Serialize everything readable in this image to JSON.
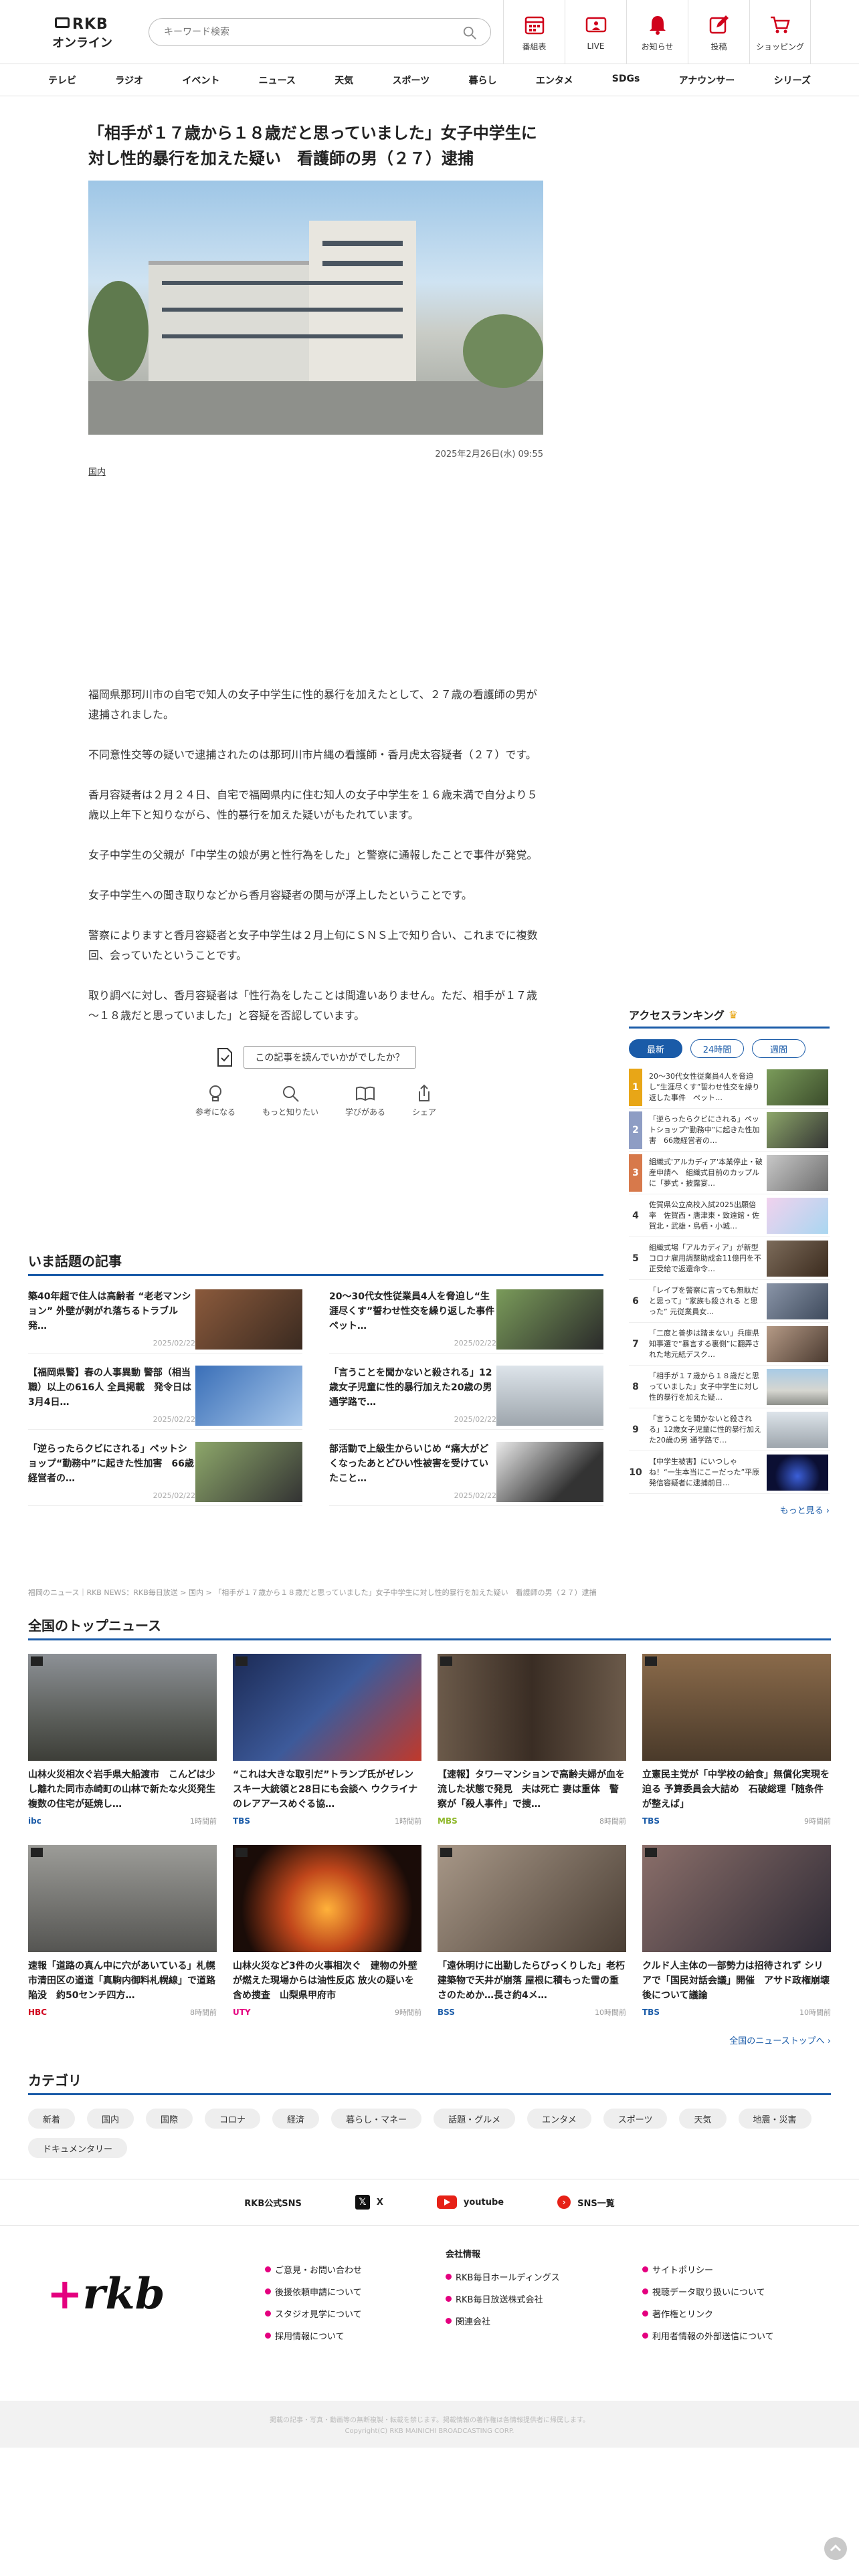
{
  "header": {
    "logo_top": "RKB",
    "logo_bottom": "オンライン",
    "search_placeholder": "キーワード検索",
    "nav": [
      {
        "label": "番組表"
      },
      {
        "label": "LIVE"
      },
      {
        "label": "お知らせ"
      },
      {
        "label": "投稿"
      },
      {
        "label": "ショッピング"
      }
    ]
  },
  "categories_nav": [
    "テレビ",
    "ラジオ",
    "イベント",
    "ニュース",
    "天気",
    "スポーツ",
    "暮らし",
    "エンタメ",
    "SDGs",
    "アナウンサー",
    "シリーズ"
  ],
  "article": {
    "title": "「相手が１７歳から１８歳だと思っていました」女子中学生に対し性的暴行を加えた疑い　看護師の男（２７）逮捕",
    "date": "2025年2月26日(水) 09:55",
    "tag": "国内",
    "paragraphs": [
      "福岡県那珂川市の自宅で知人の女子中学生に性的暴行を加えたとして、２７歳の看護師の男が逮捕されました。",
      "不同意性交等の疑いで逮捕されたのは那珂川市片縄の看護師・香月虎太容疑者（２７）です。",
      "香月容疑者は２月２４日、自宅で福岡県内に住む知人の女子中学生を１６歳未満で自分より５歳以上年下と知りながら、性的暴行を加えた疑いがもたれています。",
      "女子中学生の父親が「中学生の娘が男と性行為をした」と警察に通報したことで事件が発覚。",
      "女子中学生への聞き取りなどから香月容疑者の関与が浮上したということです。",
      "警察によりますと香月容疑者と女子中学生は２月上旬にＳＮＳ上で知り合い、これまでに複数回、会っていたということです。",
      "取り調べに対し、香月容疑者は「性行為をしたことは間違いありません。ただ、相手が１７歳～１８歳だと思っていました」と容疑を否認しています。"
    ],
    "feedback_label": "この記事を読んでいかがでしたか？",
    "reactions": [
      "参考になる",
      "もっと知りたい",
      "学びがある",
      "シェア"
    ]
  },
  "trending": {
    "title": "いま話題の記事",
    "items": [
      {
        "title": "築40年超で住人は高齢者 “老老マンション” 外壁が剥がれ落ちるトラブル発…",
        "date": "2025/02/22"
      },
      {
        "title": "20～30代女性従業員4人を脅迫し“生涯尽くす”誓わせ性交を繰り返した事件　ペット…",
        "date": "2025/02/22"
      },
      {
        "title": "【福岡県警】春の人事異動 警部（相当職）以上の616人 全員掲載　発令日は3月4日…",
        "date": "2025/02/22"
      },
      {
        "title": "「言うことを聞かないと殺される」12歳女子児童に性的暴行加えた20歳の男 通学路で…",
        "date": "2025/02/22"
      },
      {
        "title": "「逆らったらクビにされる」ペットショップ“勤務中”に起きた性加害　66歳経営者の…",
        "date": "2025/02/22"
      },
      {
        "title": "部活動で上級生からいじめ “痛大がどくなったあとどひい性被害を受けていたこと…",
        "date": "2025/02/22"
      }
    ]
  },
  "ranking": {
    "title": "アクセスランキング",
    "tabs": [
      "最新",
      "24時間",
      "週間"
    ],
    "more": "もっと見る",
    "items": [
      {
        "num": "1",
        "title": "20～30代女性従業員4人を脅迫し“生涯尽くす”誓わせ性交を繰り返した事件　ペット…",
        "color": "#e8a617"
      },
      {
        "num": "2",
        "title": "「逆らったらクビにされる」ペットショップ“勤務中”に起きた性加害　66歳経営者の…",
        "color": "#8e9dc4"
      },
      {
        "num": "3",
        "title": "組織式'アルカディア'本業停止・破産申請へ　組織式目前のカップルに「夢式・披露宴…",
        "color": "#d7794b"
      },
      {
        "num": "4",
        "title": "佐賀県公立高校入試2025出願倍率　佐賀西・唐津東・致遠館・佐賀北・武雄・鳥栖・小城…",
        "color": ""
      },
      {
        "num": "5",
        "title": "組織式場「アルカディア」が新型コロナ雇用調整助成金11億円を不正受給で返還命令…",
        "color": ""
      },
      {
        "num": "6",
        "title": "「レイプを警察に言っても無駄だと思って」“家族も殺される と思った” 元従業員女…",
        "color": ""
      },
      {
        "num": "7",
        "title": "「二度と善歩は踏まない」兵庫県知事選で“暴言する裏側”に翻弄された地元紙デスク…",
        "color": ""
      },
      {
        "num": "8",
        "title": "「相手が１７歳から１８歳だと思っていました」女子中学生に対し性的暴行を加えた疑…",
        "color": ""
      },
      {
        "num": "9",
        "title": "「言うことを聞かないと殺される」12歳女子児童に性的暴行加えた20歳の男 通学路で…",
        "color": ""
      },
      {
        "num": "10",
        "title": "【中学生被害】にいつしゃね！“一生本当にこーだった”平原発信容疑者に逮捕前日…",
        "color": ""
      }
    ]
  },
  "breadcrumb": "福岡のニュース｜RKB NEWS：RKB毎日放送 > 国内 > 「相手が１７歳から１８歳だと思っていました」女子中学生に対し性的暴行を加えた疑い　看護師の男（２７）逮捕",
  "topnews": {
    "title": "全国のトップニュース",
    "link": "全国のニューストップへ",
    "items": [
      {
        "title": "山林火災相次ぐ岩手県大船渡市　こんどは少し離れた同市赤崎町の山林で新たな火災発生　複数の住宅が延焼し…",
        "src": "ibc",
        "ago": "1時間前",
        "srccolor": "#1a5ba8"
      },
      {
        "title": "“これは大きな取引だ”トランプ氏がゼレンスキー大統領と28日にも会談へ ウクライナのレアアースめぐる協…",
        "src": "TBS",
        "ago": "1時間前",
        "srccolor": "#1a5ba8"
      },
      {
        "title": "【速報】タワーマンションで高齢夫婦が血を流した状態で発見　夫は死亡 妻は重体　警察が「殺人事件」で捜…",
        "src": "MBS",
        "ago": "8時間前",
        "srccolor": "#8fb82b"
      },
      {
        "title": "立憲民主党が「中学校の給食」無償化実現を迫る 予算委員会大詰め　石破総理「随条件が整えば」",
        "src": "TBS",
        "ago": "9時間前",
        "srccolor": "#1a5ba8"
      },
      {
        "title": "速報「道路の真ん中に穴があいている」札幌市清田区の道道「真駒内御料札幌線」で道路陥没　約50センチ四方…",
        "src": "HBC",
        "ago": "8時間前",
        "srccolor": "#d0021b"
      },
      {
        "title": "山林火災など3件の火事相次ぐ　建物の外壁が燃えた現場からは油性反応 放火の疑いを含め捜査　山梨県甲府市",
        "src": "UTY",
        "ago": "9時間前",
        "srccolor": "#e4007f"
      },
      {
        "title": "「遠休明けに出勤したらびっくりした」老朽建築物で天井が崩落 屋根に積もった雪の重さのためか…長さ約4メ…",
        "src": "BSS",
        "ago": "10時間前",
        "srccolor": "#1a5ba8"
      },
      {
        "title": "クルド人主体の一部勢力は招待されず シリアで「国民対話会議」開催　アサド政権崩壊後について議論",
        "src": "TBS",
        "ago": "10時間前",
        "srccolor": "#1a5ba8"
      }
    ]
  },
  "categories": {
    "title": "カテゴリ",
    "items": [
      "新着",
      "国内",
      "国際",
      "コロナ",
      "経済",
      "暮らし・マネー",
      "話題・グルメ",
      "エンタメ",
      "スポーツ",
      "天気",
      "地震・災害",
      "ドキュメンタリー"
    ]
  },
  "sns": {
    "label": "RKB公式SNS",
    "items": [
      "X",
      "youtube",
      "SNS一覧"
    ]
  },
  "footer": {
    "logo": "rkb",
    "col1": [
      "ご意見・お問い合わせ",
      "後援依頼申請について",
      "スタジオ見学について",
      "採用情報について"
    ],
    "col2_head": "会社情報",
    "col2": [
      "RKB毎日ホールディングス",
      "RKB毎日放送株式会社",
      "関連会社"
    ],
    "col3": [
      "サイトポリシー",
      "視聴データ取り扱いについて",
      "著作権とリンク",
      "利用者情報の外部送信について"
    ],
    "copyright1": "掲載の記事・写真・動画等の無断複製・転載を禁じます。掲載情報の著作権は各情報提供者に帰属します。",
    "copyright2": "Copyright(C) RKB MAINICHI BROADCASTING CORP."
  }
}
